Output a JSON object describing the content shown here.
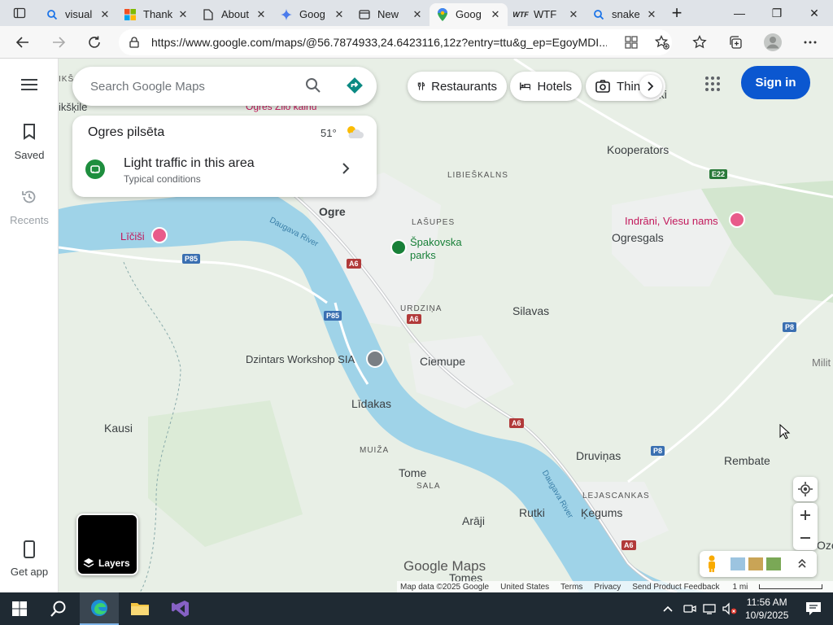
{
  "browser": {
    "tabs": [
      {
        "title": "visual",
        "icon": "search-icon",
        "active": false
      },
      {
        "title": "Thank",
        "icon": "microsoft-icon",
        "active": false
      },
      {
        "title": "About",
        "icon": "document-icon",
        "active": false
      },
      {
        "title": "Goog",
        "icon": "gemini-icon",
        "active": false
      },
      {
        "title": "New",
        "icon": "newtab-icon",
        "active": false
      },
      {
        "title": "Goog",
        "icon": "maps-pin-icon",
        "active": true
      },
      {
        "title": "WTF",
        "icon": "wtf-icon",
        "active": false
      },
      {
        "title": "snake",
        "icon": "search-icon",
        "active": false
      }
    ],
    "url": "https://www.google.com/maps/@56.7874933,24.6423116,12z?entry=ttu&g_ep=EgoyMDI..."
  },
  "maps": {
    "search_placeholder": "Search Google Maps",
    "rail": {
      "saved": "Saved",
      "recents": "Recents",
      "get_app": "Get app"
    },
    "card": {
      "place": "Ogres pilsēta",
      "temperature": "51°",
      "traffic_title": "Light traffic in this area",
      "traffic_sub": "Typical conditions"
    },
    "chips": {
      "restaurants": "Restaurants",
      "hotels": "Hotels",
      "things": "Thing"
    },
    "signin": "Sign in",
    "layers": "Layers",
    "labels": {
      "ikskile": "ikšķile",
      "ikss": "IKŠ",
      "ogres_zilo": "Ogres Zilo kalnu",
      "libieskalns": "LIBIEŠKALNS",
      "kooperators": "Kooperators",
      "e22": "E22",
      "ogre": "Ogre",
      "lasupes": "LAŠUPES",
      "spakovska": "Špakovska",
      "parks": "parks",
      "indrani": "Indrāni, Viesu nams",
      "ogresgals": "Ogresgals",
      "licisi": "Līčiši",
      "p85a": "P85",
      "p85b": "P85",
      "a6a": "A6",
      "a6b": "A6",
      "a6c": "A6",
      "a6d": "A6",
      "urdzina": "URDZIŅA",
      "silavas": "Silavas",
      "ciemupe": "Ciemupe",
      "dzintars": "Dzintars Workshop SIA",
      "lidakas": "Līdakas",
      "kausi": "Kausi",
      "muiza": "MUIŽA",
      "tome": "Tome",
      "sala": "SALA",
      "druvinas": "Druviņas",
      "rembate": "Rembate",
      "p8a": "P8",
      "p8b": "P8",
      "milit": "Milit",
      "lejascankas": "LEJASCANKAS",
      "kegums": "Ķegums",
      "rutki": "Rutki",
      "araji": "Arāji",
      "tomes": "Tomes",
      "oze": "Oze",
      "daugava_1": "Daugava River",
      "daugava_2": "Daugava River",
      "uki": "uki"
    },
    "logo": "Google Maps",
    "footer": [
      "Map data ©2025 Google",
      "United States",
      "Terms",
      "Privacy",
      "Send Product Feedback"
    ],
    "scale": "1 mi"
  },
  "taskbar": {
    "time": "11:56 AM",
    "date": "10/9/2025"
  }
}
